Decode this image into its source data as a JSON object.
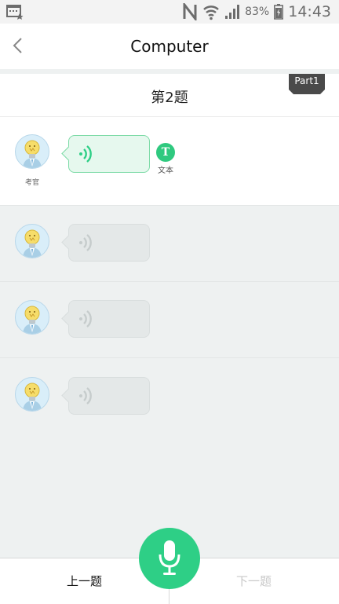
{
  "status_bar": {
    "battery_percent": "83%",
    "time": "14:43"
  },
  "header": {
    "title": "Computer"
  },
  "question": {
    "title": "第2题",
    "part_label": "Part1"
  },
  "dialogue": {
    "examiner_label": "考官",
    "text_toggle_glyph": "T",
    "text_toggle_label": "文本"
  },
  "bottom_nav": {
    "prev_label": "上一题",
    "next_label": "下一题"
  },
  "colors": {
    "accent": "#2ecf86",
    "part_tag": "#4a4a4a"
  }
}
